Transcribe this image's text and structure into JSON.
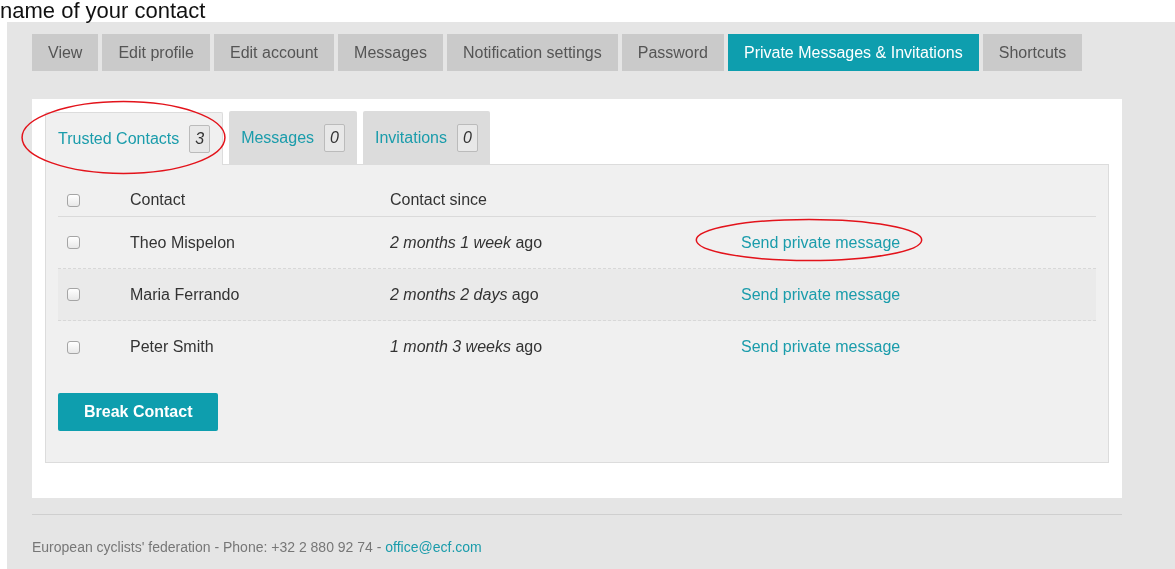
{
  "heading_fragment": "name of your contact",
  "tabs": [
    {
      "label": "View",
      "selected": false
    },
    {
      "label": "Edit profile",
      "selected": false
    },
    {
      "label": "Edit account",
      "selected": false
    },
    {
      "label": "Messages",
      "selected": false
    },
    {
      "label": "Notification settings",
      "selected": false
    },
    {
      "label": "Password",
      "selected": false
    },
    {
      "label": "Private Messages & Invitations",
      "selected": true
    },
    {
      "label": "Shortcuts",
      "selected": false
    }
  ],
  "subtabs": [
    {
      "label": "Trusted Contacts",
      "count": "3",
      "selected": true,
      "circled": true
    },
    {
      "label": "Messages",
      "count": "0",
      "selected": false,
      "circled": false
    },
    {
      "label": "Invitations",
      "count": "0",
      "selected": false,
      "circled": false
    }
  ],
  "table": {
    "select_all_checked": false,
    "columns": [
      "Contact",
      "Contact since"
    ],
    "rows": [
      {
        "checked": false,
        "contact": "Theo Mispelon",
        "since": "*2 months 1 week* ago",
        "action": "Send private message",
        "circled": true
      },
      {
        "checked": false,
        "contact": "Maria Ferrando",
        "since": "*2 months 2 days* ago",
        "action": "Send private message",
        "circled": false
      },
      {
        "checked": false,
        "contact": "Peter Smith",
        "since": "*1 month 3 weeks* ago",
        "action": "Send private message",
        "circled": false
      }
    ]
  },
  "break_button": "Break Contact",
  "footer": {
    "text": "European cyclists' federation - Phone: +32 2 880 92 74 - ",
    "email": "office@ecf.com"
  }
}
